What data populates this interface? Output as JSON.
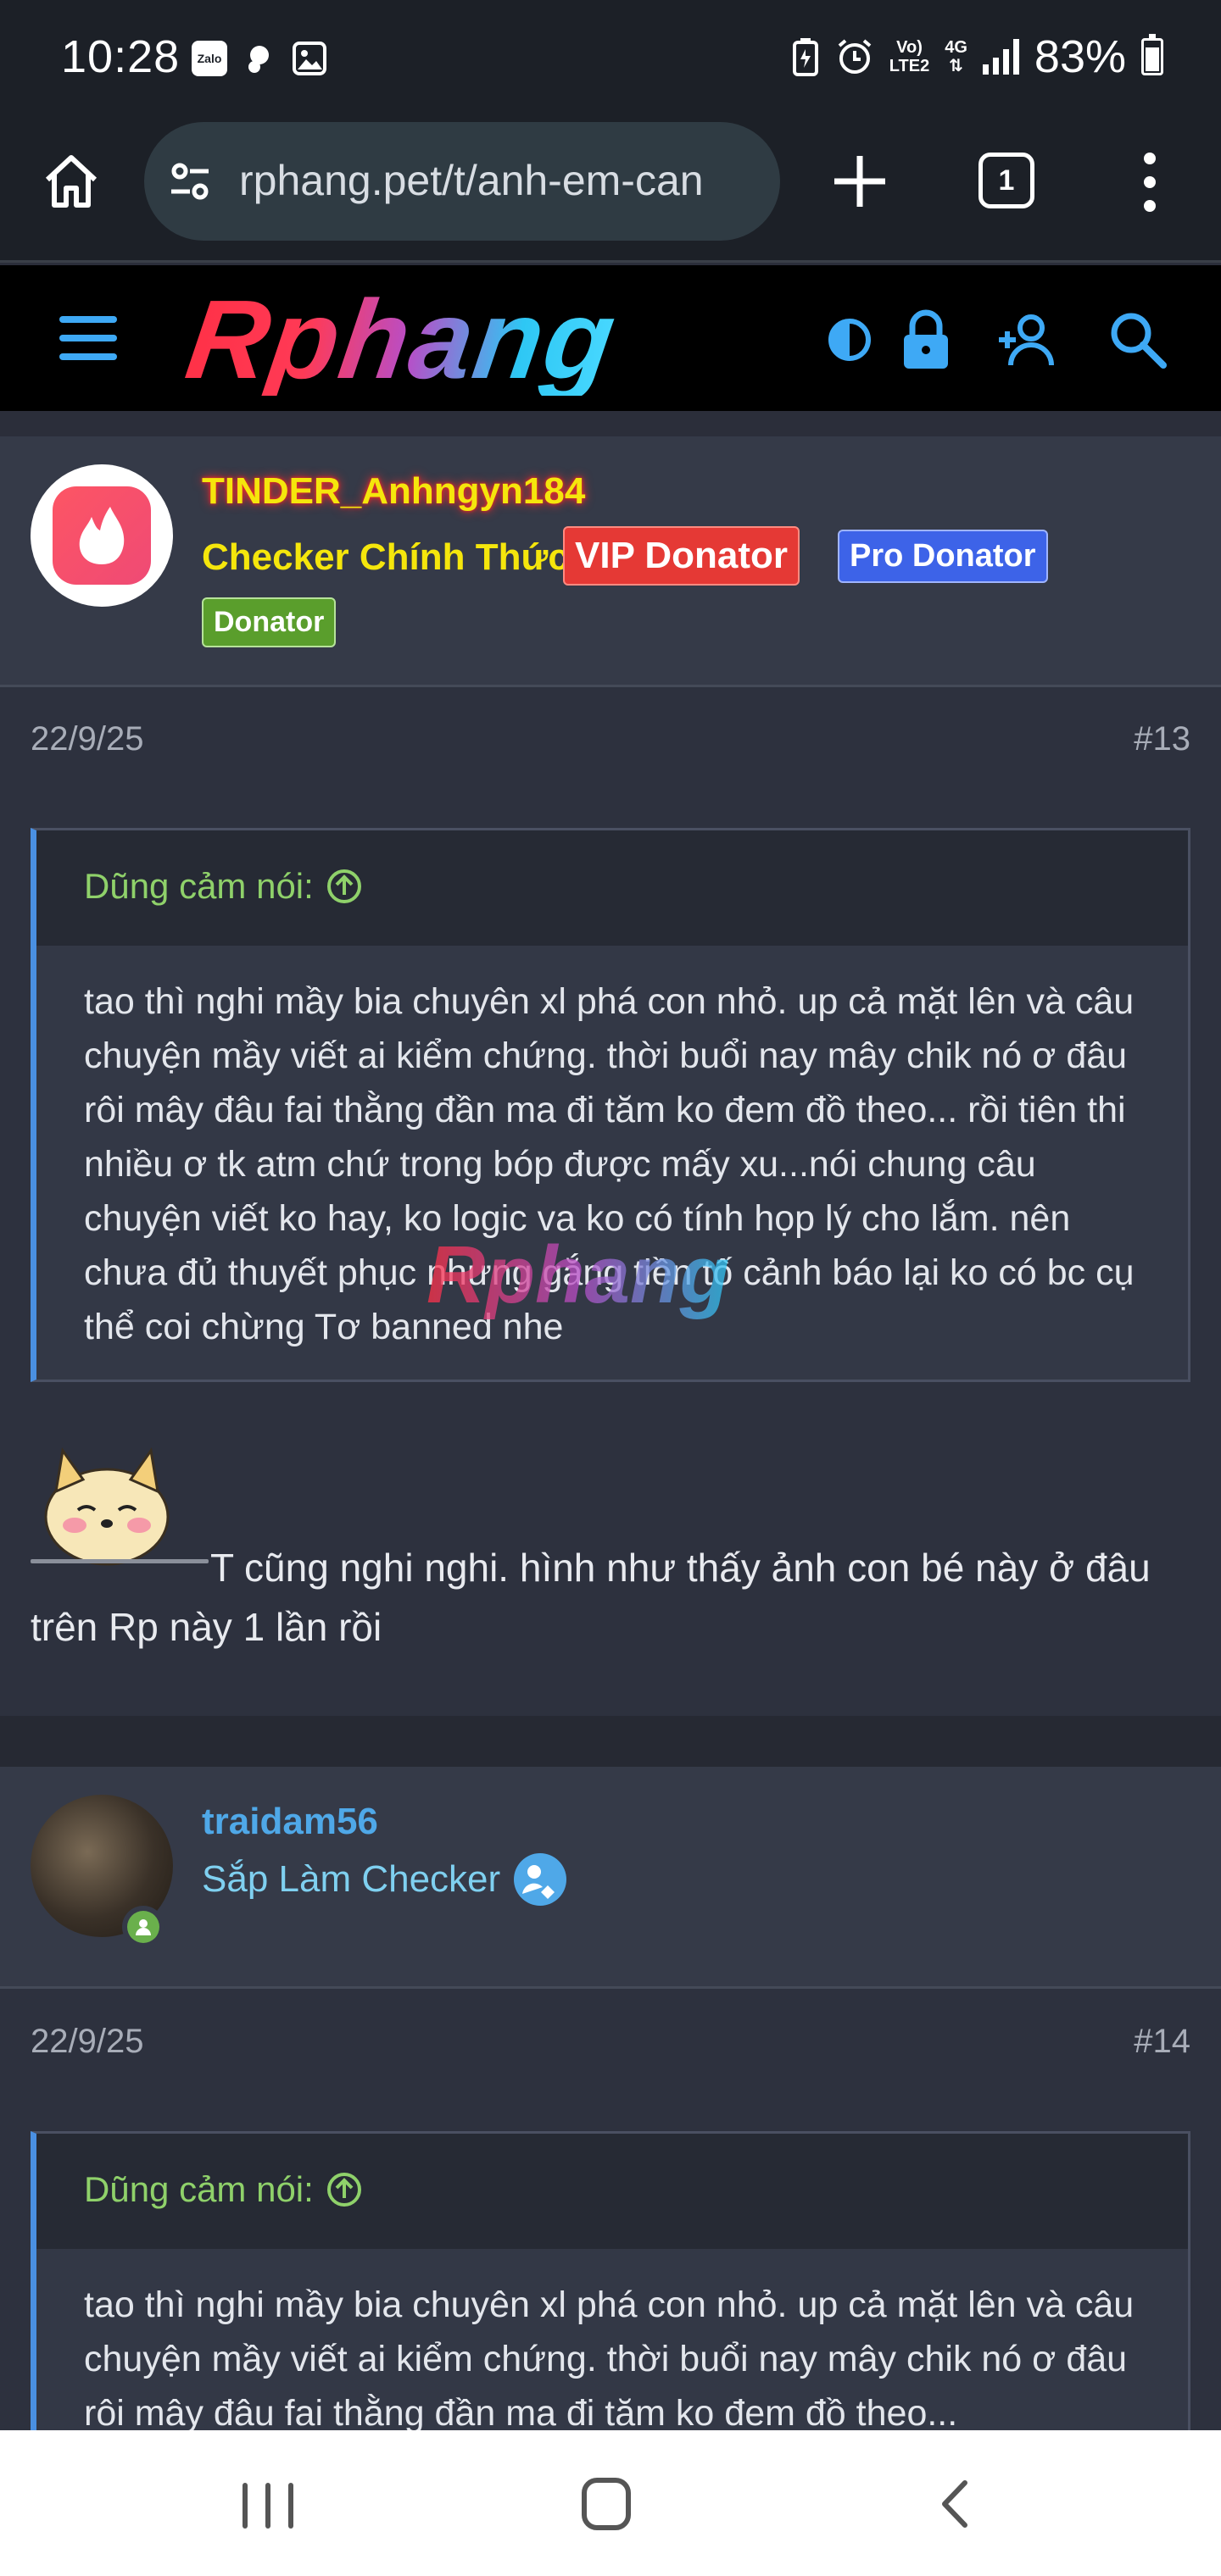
{
  "status_bar": {
    "time": "10:28",
    "left_icons": [
      "zalo-icon",
      "messenger-bubble-icon",
      "gallery-icon"
    ],
    "zalo_label": "Zalo",
    "network_top": "Vo)",
    "network_bottom": "LTE2",
    "network_gen": "4G",
    "battery": "83%"
  },
  "browser": {
    "url": "rphang.pet/t/anh-em-can",
    "tab_count": "1",
    "icons": [
      "home-icon",
      "page-info-icon",
      "new-tab-icon",
      "tab-switcher-icon",
      "more-menu-icon"
    ]
  },
  "site_header": {
    "logo": "Rphang",
    "icons": [
      "menu-icon",
      "theme-toggle-icon",
      "lock-icon",
      "add-user-icon",
      "search-icon"
    ]
  },
  "posts": [
    {
      "username": "TINDER_Anhngyn184",
      "user_title": "Checker Chính Thức",
      "badges": [
        {
          "label": "VIP Donator",
          "color": "#e53935"
        },
        {
          "label": "Pro Donator",
          "color": "#3d63e8"
        },
        {
          "label": "Donator",
          "color": "#5a9e2c"
        }
      ],
      "date": "22/9/25",
      "number": "#13",
      "quote_author": "Dũng cảm nói:",
      "quote_text": "tao thì nghi mầy bia chuyên xl phá con nhỏ. up cả mặt lên và câu chuyện mầy viết ai kiểm chứng. thời buổi nay mây chik nó ơ đâu rôi mây đâu fai thằng đần ma đi tăm ko đem đồ theo... rồi tiên thi nhiều ơ tk atm chứ trong bóp được mấy xu...nói chung câu chuyện viết ko hay, ko logic va ko có tính họp lý cho lắm. nên chưa đủ thuyết phục nhưng gắng tiền tố cảnh báo lại ko có bc cụ thể coi chừng Tơ banned nhe",
      "message": "T cũng nghi nghi. hình như thấy ảnh con bé này ở đâu trên Rp này 1 lần rồi"
    },
    {
      "username": "traidam56",
      "user_title": "Sắp Làm Checker",
      "date": "22/9/25",
      "number": "#14",
      "quote_author": "Dũng cảm nói:",
      "quote_text": "tao thì nghi mầy bia chuyên xl phá con nhỏ. up cả mặt lên và câu chuyện mầy viết ai kiểm chứng. thời buổi nay mây chik nó ơ đâu rôi mây đâu fai thằng đần ma đi tăm ko đem đồ theo..."
    }
  ],
  "colors": {
    "accent_blue": "#3ea9f5",
    "quote_green": "#8fd16a",
    "username_yellow": "#f5e60c",
    "online_green": "#6ab04c"
  }
}
